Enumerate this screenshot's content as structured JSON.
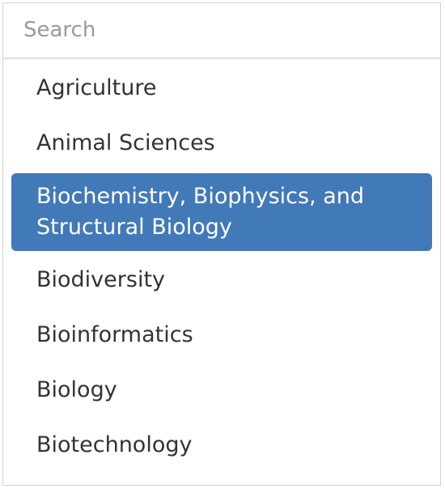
{
  "search": {
    "placeholder": "Search",
    "value": ""
  },
  "options": [
    {
      "label": "Agriculture",
      "selected": false
    },
    {
      "label": "Animal Sciences",
      "selected": false
    },
    {
      "label": "Biochemistry, Biophysics, and Structural Biology",
      "selected": true
    },
    {
      "label": "Biodiversity",
      "selected": false
    },
    {
      "label": "Bioinformatics",
      "selected": false
    },
    {
      "label": "Biology",
      "selected": false
    },
    {
      "label": "Biotechnology",
      "selected": false
    }
  ],
  "colors": {
    "selected_background": "#4279b8",
    "selected_text": "#ffffff",
    "text": "#333333",
    "placeholder": "#9a9a9a",
    "border": "#d3d3d3"
  }
}
